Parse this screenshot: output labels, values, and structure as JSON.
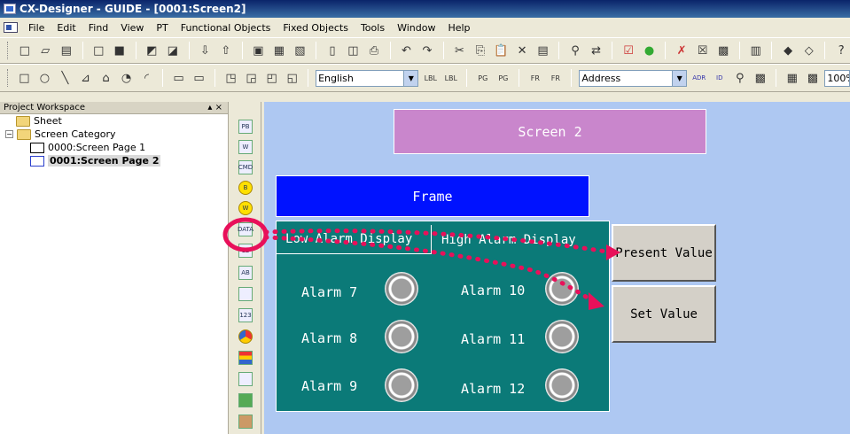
{
  "window": {
    "title": "CX-Designer - GUIDE - [0001:Screen2]"
  },
  "menu": {
    "items": [
      "File",
      "Edit",
      "Find",
      "View",
      "PT",
      "Functional Objects",
      "Fixed Objects",
      "Tools",
      "Window",
      "Help"
    ]
  },
  "toolbar": {
    "language": "English",
    "address_mode": "Address",
    "zoom": "100%"
  },
  "workspace": {
    "title": "Project Workspace",
    "pin_close": "▴ ×",
    "tree": {
      "sheet": "Sheet",
      "category": "Screen Category",
      "page1": "0000:Screen Page 1",
      "page2": "0001:Screen Page 2"
    }
  },
  "palette": {
    "icons": [
      "PB",
      "W",
      "CMD",
      "B",
      "W",
      "DATA",
      "12",
      "AB",
      "list",
      "123",
      "gauge",
      "bar",
      "graph",
      "video",
      "alarm"
    ]
  },
  "screen": {
    "title_box": "Screen 2",
    "frame": "Frame",
    "tabs": {
      "low": "Low Alarm Display",
      "high": "High Alarm Display"
    },
    "alarms_left": [
      "Alarm 7",
      "Alarm 8",
      "Alarm 9"
    ],
    "alarms_right": [
      "Alarm 10",
      "Alarm 11",
      "Alarm 12"
    ],
    "buttons": {
      "present": "Present Value",
      "set": "Set Value"
    }
  },
  "colors": {
    "canvas": "#aec8f2",
    "screen_box": "#c986cc",
    "frame": "#0012ff",
    "panel": "#0b7a78",
    "annotation": "#e8105a"
  }
}
